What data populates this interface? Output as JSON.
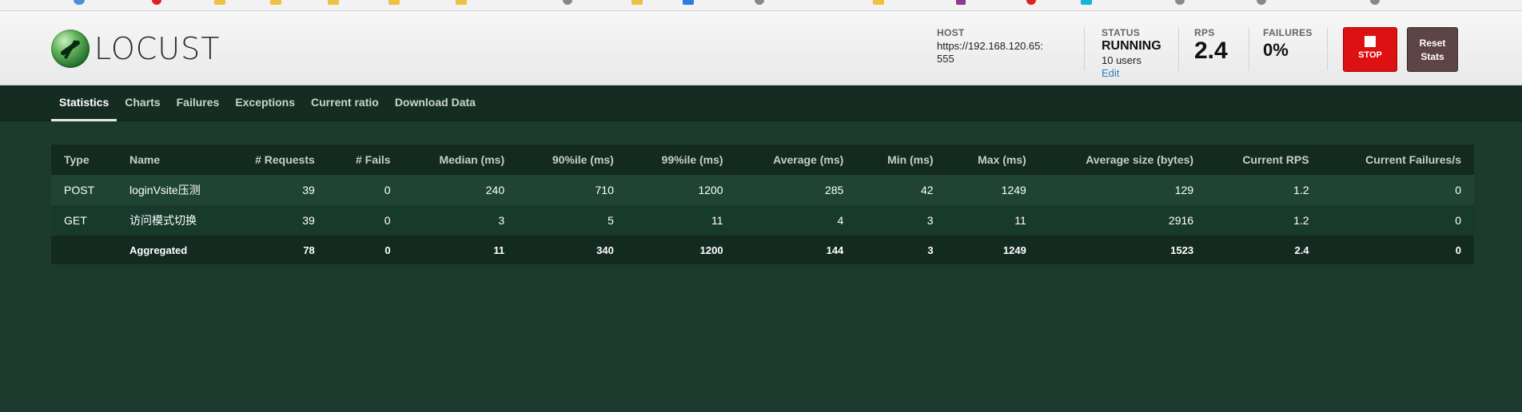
{
  "app": {
    "logo_text": "LOCUST"
  },
  "header": {
    "host_label": "HOST",
    "host_value": "https://192.168.120.65:555",
    "status_label": "STATUS",
    "status_value": "RUNNING",
    "users_text": "10 users",
    "edit_label": "Edit",
    "rps_label": "RPS",
    "rps_value": "2.4",
    "failures_label": "FAILURES",
    "failures_value": "0%",
    "stop_label": "STOP",
    "reset_label_line1": "Reset",
    "reset_label_line2": "Stats",
    "stop_color": "#dd1111",
    "reset_color": "#5d4445"
  },
  "nav": {
    "tabs": [
      {
        "label": "Statistics",
        "active": true
      },
      {
        "label": "Charts",
        "active": false
      },
      {
        "label": "Failures",
        "active": false
      },
      {
        "label": "Exceptions",
        "active": false
      },
      {
        "label": "Current ratio",
        "active": false
      },
      {
        "label": "Download Data",
        "active": false
      }
    ]
  },
  "table": {
    "columns": [
      "Type",
      "Name",
      "# Requests",
      "# Fails",
      "Median (ms)",
      "90%ile (ms)",
      "99%ile (ms)",
      "Average (ms)",
      "Min (ms)",
      "Max (ms)",
      "Average size (bytes)",
      "Current RPS",
      "Current Failures/s"
    ],
    "rows": [
      [
        "POST",
        "loginVsite压测",
        "39",
        "0",
        "240",
        "710",
        "1200",
        "285",
        "42",
        "1249",
        "129",
        "1.2",
        "0"
      ],
      [
        "GET",
        "访问模式切换",
        "39",
        "0",
        "3",
        "5",
        "11",
        "4",
        "3",
        "11",
        "2916",
        "1.2",
        "0"
      ]
    ],
    "aggregated": [
      "",
      "Aggregated",
      "78",
      "0",
      "11",
      "340",
      "1200",
      "144",
      "3",
      "1249",
      "1523",
      "2.4",
      "0"
    ]
  },
  "colors": {
    "page_bg": "#1c3b2e",
    "nav_bg": "#152c22",
    "row_even": "#1f4434",
    "row_odd": "#183a2c",
    "header_row": "#132a20"
  }
}
